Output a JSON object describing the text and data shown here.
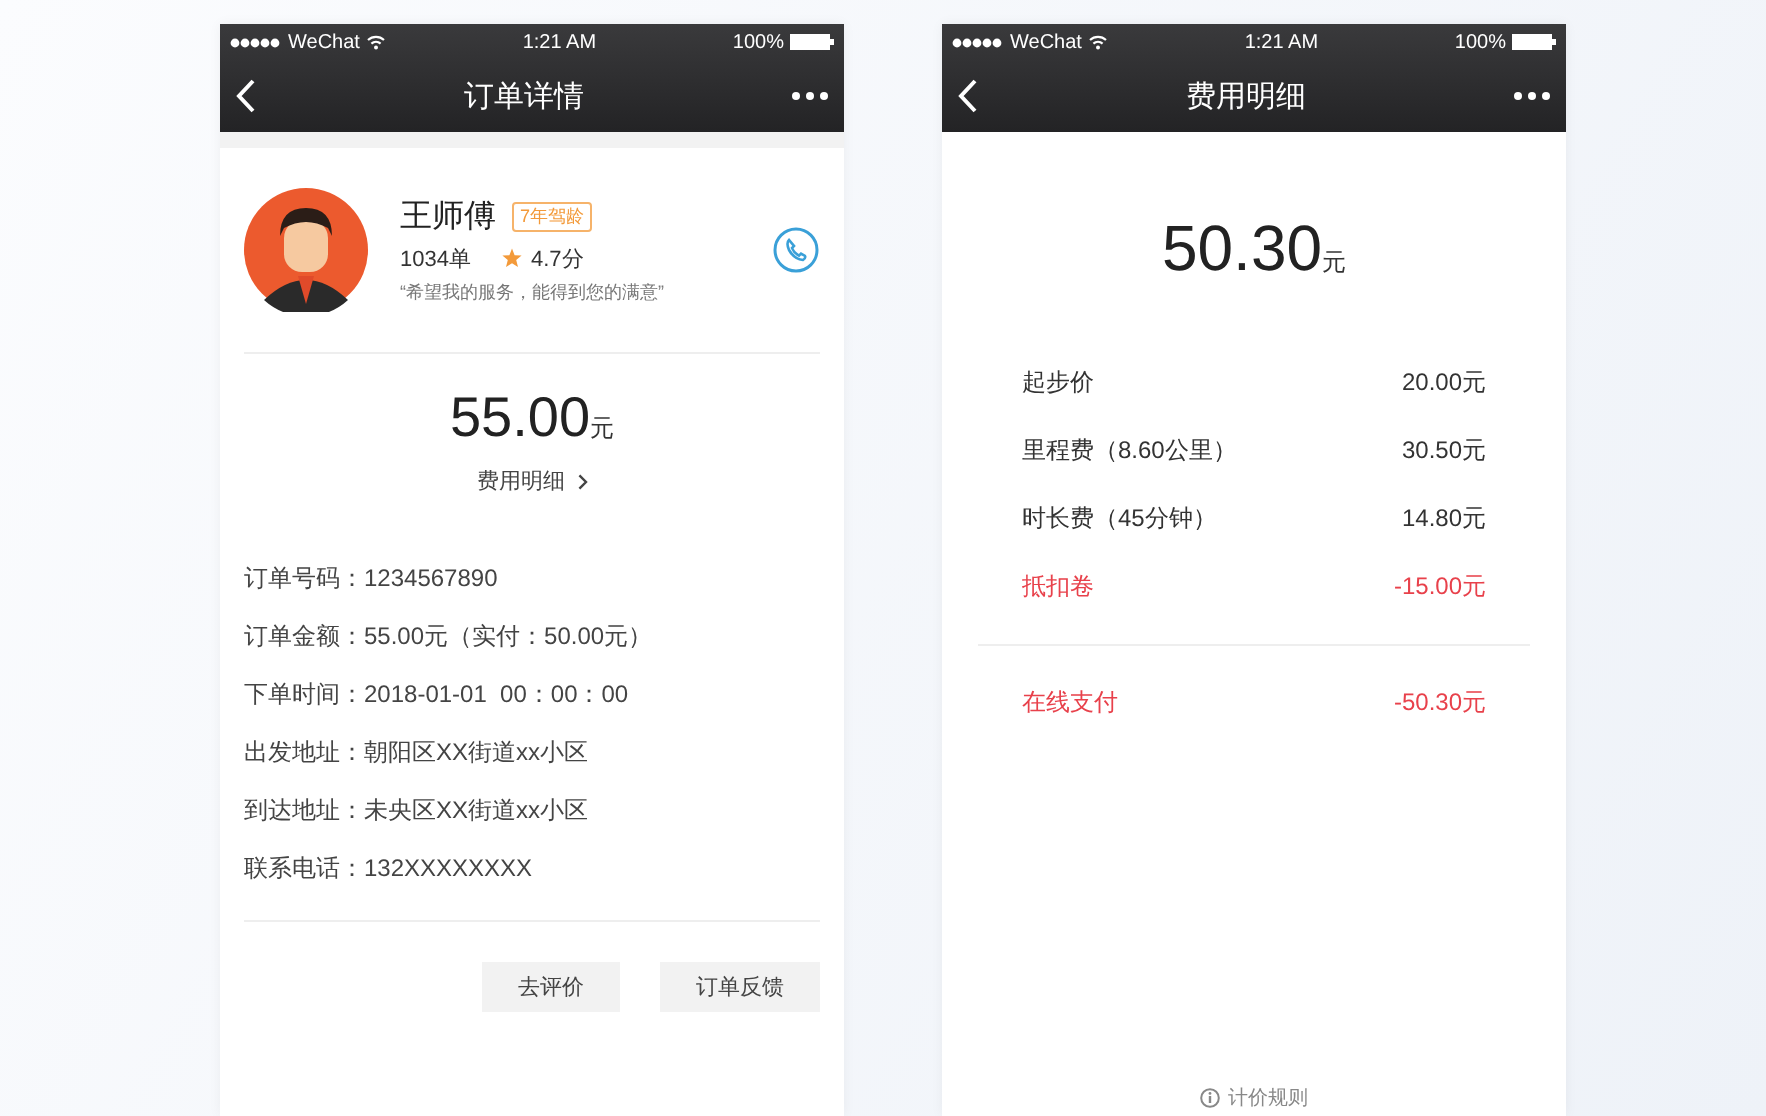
{
  "order_screen": {
    "status_bar": {
      "carrier": "WeChat",
      "time": "1:21 AM",
      "battery": "100%"
    },
    "nav": {
      "title": "订单详情"
    },
    "driver": {
      "name": "王师傅",
      "badge": "7年驾龄",
      "orders": "1034单",
      "rating": "4.7分",
      "quote": "“希望我的服务，能得到您的满意”"
    },
    "price": {
      "amount": "55.00",
      "unit": "元",
      "link": "费用明细"
    },
    "details": [
      {
        "label": "订单号码：",
        "value": "1234567890"
      },
      {
        "label": "订单金额：",
        "value": "55.00元（实付：50.00元）"
      },
      {
        "label": "下单时间：",
        "value": "2018-01-01  00：00：00"
      },
      {
        "label": "出发地址：",
        "value": "朝阳区XX街道xx小区"
      },
      {
        "label": "到达地址：",
        "value": "未央区XX街道xx小区"
      },
      {
        "label": "联系电话：",
        "value": "132XXXXXXXX"
      }
    ],
    "buttons": [
      "去评价",
      "订单反馈"
    ]
  },
  "fee_screen": {
    "status_bar": {
      "carrier": "WeChat",
      "time": "1:21 AM",
      "battery": "100%"
    },
    "nav": {
      "title": "费用明细"
    },
    "total": {
      "amount": "50.30",
      "unit": "元"
    },
    "items": [
      {
        "label": "起步价",
        "value": "20.00元",
        "kind": "charge"
      },
      {
        "label": "里程费（8.60公里）",
        "value": "30.50元",
        "kind": "charge"
      },
      {
        "label": "时长费（45分钟）",
        "value": "14.80元",
        "kind": "charge"
      },
      {
        "label": "抵扣卷",
        "value": "-15.00元",
        "kind": "deduction"
      }
    ],
    "payment": {
      "label": "在线支付",
      "value": "-50.30元",
      "kind": "deduction"
    },
    "footer_link": "计价规则"
  }
}
